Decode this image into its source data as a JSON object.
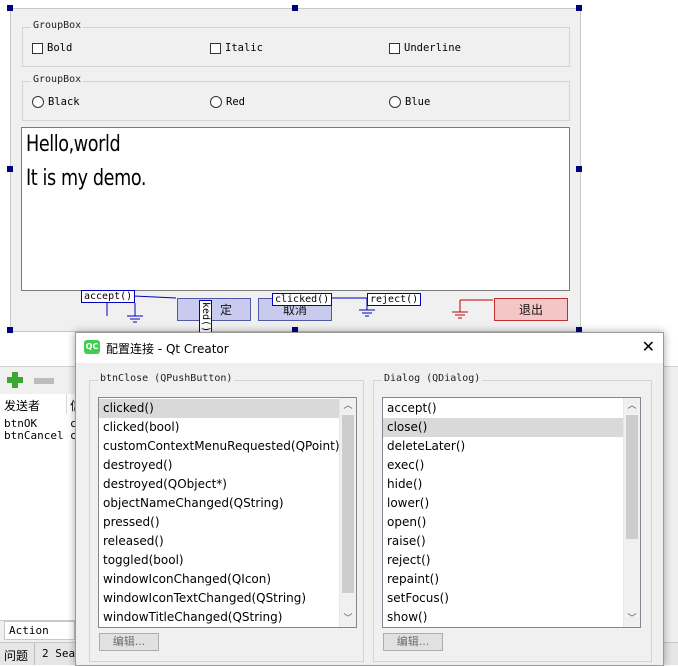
{
  "form": {
    "groupbox1": {
      "title": "GroupBox",
      "checkboxes": [
        "Bold",
        "Italic",
        "Underline"
      ]
    },
    "groupbox2": {
      "title": "GroupBox",
      "radios": [
        "Black",
        "Red",
        "Blue"
      ]
    },
    "textedit": {
      "line1": "Hello,world",
      "line2": "It is my demo."
    },
    "buttons": {
      "ok_label": "定",
      "ok_vertical_label": "ked()",
      "cancel_label": "取消",
      "quit_label": "退出"
    },
    "signal_labels": {
      "accept": "accept()",
      "clicked": "clicked()",
      "reject": "reject()"
    }
  },
  "lower_panel": {
    "header_sender": "发送者",
    "header_col2": "信",
    "rows": [
      {
        "sender": "btnOK",
        "rest": "c"
      },
      {
        "sender": "btnCancel",
        "rest": "c"
      }
    ],
    "bottom_tab": "Action Edit",
    "status_issues": "问题",
    "status_search": "2 Sea"
  },
  "dialog": {
    "title": "配置连接 - Qt Creator",
    "logo_text": "QC",
    "left": {
      "title": "btnClose (QPushButton)",
      "items": [
        "clicked()",
        "clicked(bool)",
        "customContextMenuRequested(QPoint)",
        "destroyed()",
        "destroyed(QObject*)",
        "objectNameChanged(QString)",
        "pressed()",
        "released()",
        "toggled(bool)",
        "windowIconChanged(QIcon)",
        "windowIconTextChanged(QString)",
        "windowTitleChanged(QString)"
      ],
      "selected_index": 0,
      "edit_label": "编辑..."
    },
    "right": {
      "title": "Dialog (QDialog)",
      "items": [
        "accept()",
        "close()",
        "deleteLater()",
        "exec()",
        "hide()",
        "lower()",
        "open()",
        "raise()",
        "reject()",
        "repaint()",
        "setFocus()",
        "show()"
      ],
      "selected_index": 1,
      "edit_label": "编辑..."
    }
  }
}
